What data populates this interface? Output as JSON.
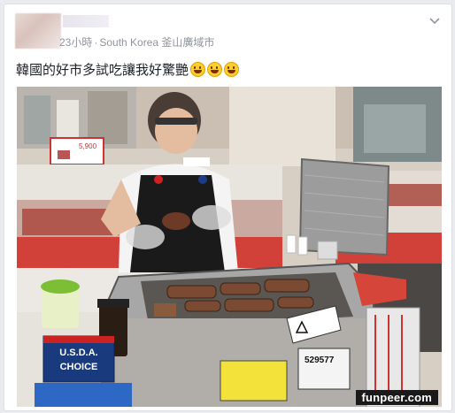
{
  "post": {
    "time": "23小時",
    "separator": "·",
    "location": "South Korea 釜山廣域市",
    "text": "韓國的好市多試吃讓我好驚艷",
    "emojis": [
      "grinning-face",
      "grinning-face",
      "grinning-face"
    ]
  },
  "photo": {
    "price_tag": "5,900",
    "usda_line1": "U.S.D.A.",
    "usda_line2": "CHOICE",
    "number_sign": "529577",
    "watermark": "funpeer.com"
  },
  "colors": {
    "background": "#e9ebee",
    "card": "#ffffff",
    "meta_text": "#90949c",
    "post_text": "#1d2129"
  }
}
